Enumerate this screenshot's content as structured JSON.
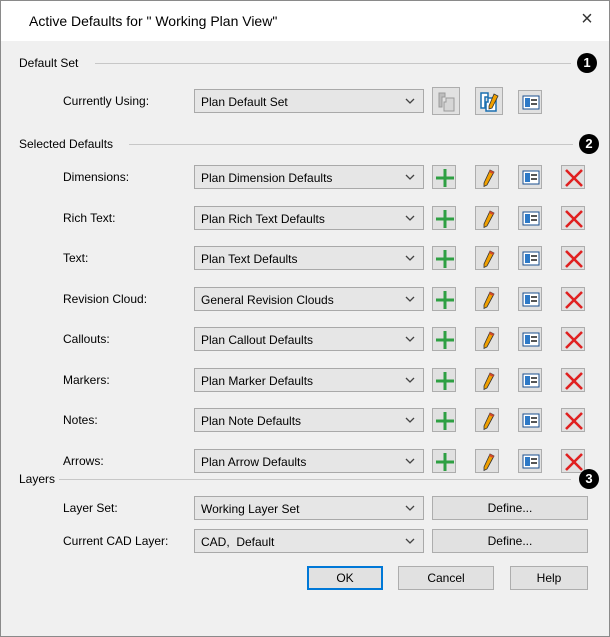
{
  "window": {
    "title": "Active Defaults for \" Working Plan View\"",
    "close_glyph": "×"
  },
  "default_set": {
    "heading": "Default Set",
    "badge": "1",
    "label": "Currently Using:",
    "value": "Plan Default Set",
    "icons": [
      "copy-default-set-icon",
      "edit-default-set-icon",
      "properties-icon"
    ]
  },
  "selected_defaults": {
    "heading": "Selected Defaults",
    "badge": "2",
    "rows": [
      {
        "label": "Dimensions:",
        "value": "Plan Dimension Defaults"
      },
      {
        "label": "Rich Text:",
        "value": "Plan Rich Text Defaults"
      },
      {
        "label": "Text:",
        "value": "Plan Text Defaults"
      },
      {
        "label": "Revision Cloud:",
        "value": "General Revision Clouds"
      },
      {
        "label": "Callouts:",
        "value": "Plan Callout Defaults"
      },
      {
        "label": "Markers:",
        "value": "Plan Marker Defaults"
      },
      {
        "label": "Notes:",
        "value": "Plan Note Defaults"
      },
      {
        "label": "Arrows:",
        "value": "Plan Arrow Defaults"
      }
    ],
    "row_icons": [
      "add-icon",
      "edit-pencil-icon",
      "properties-icon",
      "delete-icon"
    ]
  },
  "layers": {
    "heading": "Layers",
    "badge": "3",
    "layer_set_label": "Layer Set:",
    "layer_set_value": "Working Layer Set",
    "cad_layer_label": "Current CAD Layer:",
    "cad_layer_value": "CAD,  Default",
    "define_label": "Define..."
  },
  "buttons": {
    "ok": "OK",
    "cancel": "Cancel",
    "help": "Help"
  },
  "colors": {
    "add_green": "#2ea043",
    "delete_red": "#e02020",
    "pencil_orange": "#f0a000",
    "focus_blue": "#0078d7"
  }
}
